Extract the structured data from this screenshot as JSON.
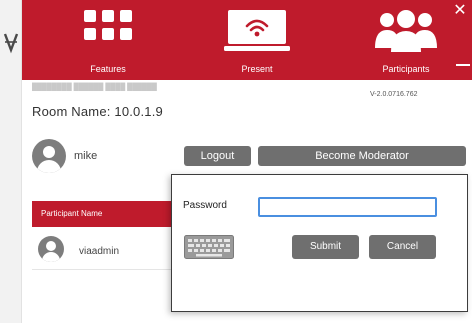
{
  "nav": {
    "features_label": "Features",
    "present_label": "Present",
    "participants_label": "Participants",
    "close_symbol": "✕",
    "icons": {
      "features": "grid-icon",
      "present": "screen-wifi-icon",
      "participants": "group-icon"
    }
  },
  "colors": {
    "brand_red": "#bf1b2c",
    "button_gray": "#6f6f6f",
    "input_focus": "#4a8fe0"
  },
  "version": "V-2.0.0716.762",
  "room": {
    "name": "Room Name: 10.0.1.9"
  },
  "user": {
    "name": "mike",
    "logout_label": "Logout",
    "moderator_label": "Become Moderator"
  },
  "participants": {
    "header": "Participant Name",
    "rows": [
      {
        "name": "viaadmin"
      }
    ]
  },
  "dialog": {
    "password_label": "Password",
    "password_value": "",
    "submit_label": "Submit",
    "cancel_label": "Cancel"
  }
}
